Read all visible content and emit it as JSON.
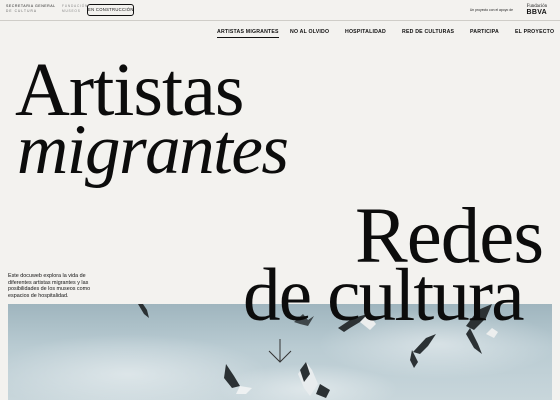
{
  "header": {
    "logo_line1": "SECRETARIA GENERAL",
    "logo_line2": "DE CULTURA",
    "logo2_line1": "FUNDACIÓN",
    "logo2_line2": "MUSEOS",
    "cta_label": "EN CONSTRUCCIÓN"
  },
  "sponsor": {
    "label": "Un proyecto con el apoyo de",
    "brand_line1": "Fundación",
    "brand_line2": "BBVA"
  },
  "nav": {
    "items": [
      {
        "label": "ARTISTAS MIGRANTES",
        "active": true
      },
      {
        "label": "NO AL OLVIDO",
        "active": false
      },
      {
        "label": "HOSPITALIDAD",
        "active": false
      },
      {
        "label": "RED DE CULTURAS",
        "active": false
      },
      {
        "label": "PARTICIPA",
        "active": false
      },
      {
        "label": "EL PROYECTO",
        "active": false
      }
    ]
  },
  "hero_titles": {
    "title1_line1": "Artistas",
    "title1_line2": "migrantes",
    "title2_line1": "Redes",
    "title2_line2": "de cultura"
  },
  "intro_text": "Este docuweb explora la vida de diferentes artistas migrantes y las posibilidades de los museos como espacios de hospitalidad.",
  "icons": {
    "scroll": "arrow-down-icon",
    "hero_image": "seagulls-in-sky-photo"
  },
  "colors": {
    "background": "#f3f2ef",
    "text": "#111111",
    "sky_top": "#9fb5be",
    "sky_bottom": "#c8d6db"
  }
}
